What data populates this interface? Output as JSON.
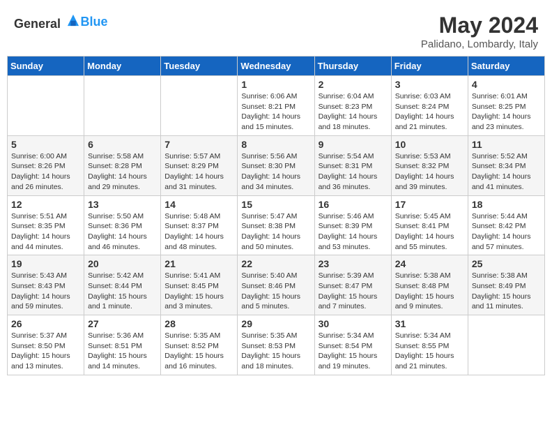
{
  "header": {
    "logo_general": "General",
    "logo_blue": "Blue",
    "month": "May 2024",
    "location": "Palidano, Lombardy, Italy"
  },
  "days_of_week": [
    "Sunday",
    "Monday",
    "Tuesday",
    "Wednesday",
    "Thursday",
    "Friday",
    "Saturday"
  ],
  "weeks": [
    [
      {
        "day": "",
        "info": ""
      },
      {
        "day": "",
        "info": ""
      },
      {
        "day": "",
        "info": ""
      },
      {
        "day": "1",
        "info": "Sunrise: 6:06 AM\nSunset: 8:21 PM\nDaylight: 14 hours\nand 15 minutes."
      },
      {
        "day": "2",
        "info": "Sunrise: 6:04 AM\nSunset: 8:23 PM\nDaylight: 14 hours\nand 18 minutes."
      },
      {
        "day": "3",
        "info": "Sunrise: 6:03 AM\nSunset: 8:24 PM\nDaylight: 14 hours\nand 21 minutes."
      },
      {
        "day": "4",
        "info": "Sunrise: 6:01 AM\nSunset: 8:25 PM\nDaylight: 14 hours\nand 23 minutes."
      }
    ],
    [
      {
        "day": "5",
        "info": "Sunrise: 6:00 AM\nSunset: 8:26 PM\nDaylight: 14 hours\nand 26 minutes."
      },
      {
        "day": "6",
        "info": "Sunrise: 5:58 AM\nSunset: 8:28 PM\nDaylight: 14 hours\nand 29 minutes."
      },
      {
        "day": "7",
        "info": "Sunrise: 5:57 AM\nSunset: 8:29 PM\nDaylight: 14 hours\nand 31 minutes."
      },
      {
        "day": "8",
        "info": "Sunrise: 5:56 AM\nSunset: 8:30 PM\nDaylight: 14 hours\nand 34 minutes."
      },
      {
        "day": "9",
        "info": "Sunrise: 5:54 AM\nSunset: 8:31 PM\nDaylight: 14 hours\nand 36 minutes."
      },
      {
        "day": "10",
        "info": "Sunrise: 5:53 AM\nSunset: 8:32 PM\nDaylight: 14 hours\nand 39 minutes."
      },
      {
        "day": "11",
        "info": "Sunrise: 5:52 AM\nSunset: 8:34 PM\nDaylight: 14 hours\nand 41 minutes."
      }
    ],
    [
      {
        "day": "12",
        "info": "Sunrise: 5:51 AM\nSunset: 8:35 PM\nDaylight: 14 hours\nand 44 minutes."
      },
      {
        "day": "13",
        "info": "Sunrise: 5:50 AM\nSunset: 8:36 PM\nDaylight: 14 hours\nand 46 minutes."
      },
      {
        "day": "14",
        "info": "Sunrise: 5:48 AM\nSunset: 8:37 PM\nDaylight: 14 hours\nand 48 minutes."
      },
      {
        "day": "15",
        "info": "Sunrise: 5:47 AM\nSunset: 8:38 PM\nDaylight: 14 hours\nand 50 minutes."
      },
      {
        "day": "16",
        "info": "Sunrise: 5:46 AM\nSunset: 8:39 PM\nDaylight: 14 hours\nand 53 minutes."
      },
      {
        "day": "17",
        "info": "Sunrise: 5:45 AM\nSunset: 8:41 PM\nDaylight: 14 hours\nand 55 minutes."
      },
      {
        "day": "18",
        "info": "Sunrise: 5:44 AM\nSunset: 8:42 PM\nDaylight: 14 hours\nand 57 minutes."
      }
    ],
    [
      {
        "day": "19",
        "info": "Sunrise: 5:43 AM\nSunset: 8:43 PM\nDaylight: 14 hours\nand 59 minutes."
      },
      {
        "day": "20",
        "info": "Sunrise: 5:42 AM\nSunset: 8:44 PM\nDaylight: 15 hours\nand 1 minute."
      },
      {
        "day": "21",
        "info": "Sunrise: 5:41 AM\nSunset: 8:45 PM\nDaylight: 15 hours\nand 3 minutes."
      },
      {
        "day": "22",
        "info": "Sunrise: 5:40 AM\nSunset: 8:46 PM\nDaylight: 15 hours\nand 5 minutes."
      },
      {
        "day": "23",
        "info": "Sunrise: 5:39 AM\nSunset: 8:47 PM\nDaylight: 15 hours\nand 7 minutes."
      },
      {
        "day": "24",
        "info": "Sunrise: 5:38 AM\nSunset: 8:48 PM\nDaylight: 15 hours\nand 9 minutes."
      },
      {
        "day": "25",
        "info": "Sunrise: 5:38 AM\nSunset: 8:49 PM\nDaylight: 15 hours\nand 11 minutes."
      }
    ],
    [
      {
        "day": "26",
        "info": "Sunrise: 5:37 AM\nSunset: 8:50 PM\nDaylight: 15 hours\nand 13 minutes."
      },
      {
        "day": "27",
        "info": "Sunrise: 5:36 AM\nSunset: 8:51 PM\nDaylight: 15 hours\nand 14 minutes."
      },
      {
        "day": "28",
        "info": "Sunrise: 5:35 AM\nSunset: 8:52 PM\nDaylight: 15 hours\nand 16 minutes."
      },
      {
        "day": "29",
        "info": "Sunrise: 5:35 AM\nSunset: 8:53 PM\nDaylight: 15 hours\nand 18 minutes."
      },
      {
        "day": "30",
        "info": "Sunrise: 5:34 AM\nSunset: 8:54 PM\nDaylight: 15 hours\nand 19 minutes."
      },
      {
        "day": "31",
        "info": "Sunrise: 5:34 AM\nSunset: 8:55 PM\nDaylight: 15 hours\nand 21 minutes."
      },
      {
        "day": "",
        "info": ""
      }
    ]
  ]
}
